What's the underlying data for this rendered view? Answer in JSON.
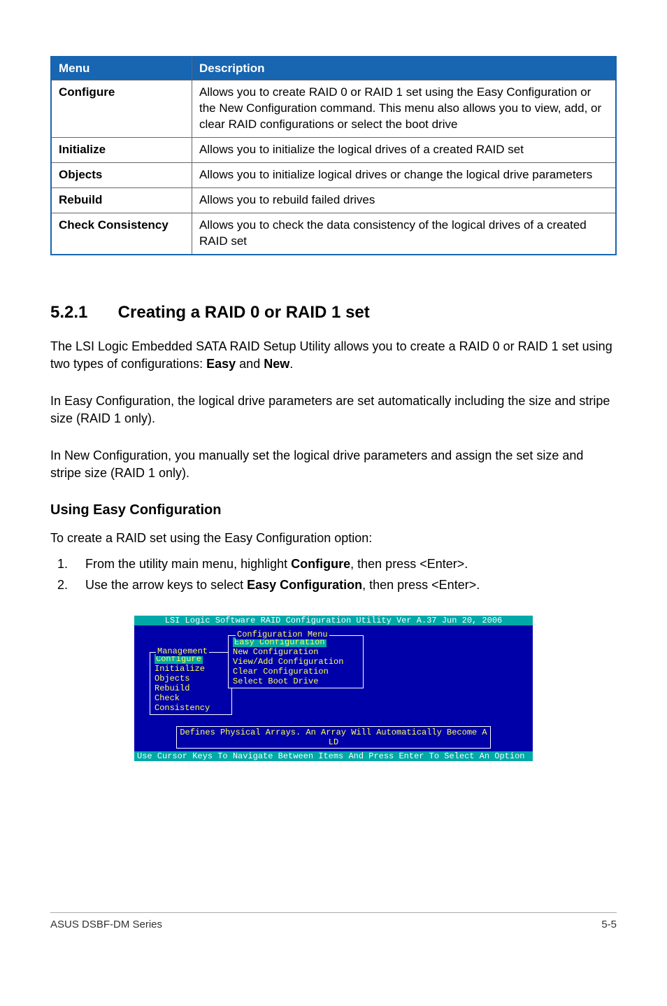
{
  "table": {
    "header": {
      "menu": "Menu",
      "desc": "Description"
    },
    "rows": [
      {
        "menu": "Configure",
        "desc": "Allows you to create RAID 0 or RAID 1 set using the Easy Configuration or the New Configuration command. This menu also allows you to view, add, or clear RAID configurations or select the boot drive"
      },
      {
        "menu": "Initialize",
        "desc": "Allows you to initialize the logical drives of a created RAID set"
      },
      {
        "menu": "Objects",
        "desc": "Allows you to initialize logical drives or change the logical drive parameters"
      },
      {
        "menu": "Rebuild",
        "desc": "Allows you to rebuild failed drives"
      },
      {
        "menu": "Check Consistency",
        "desc": "Allows you to check the data consistency of the logical drives of a created RAID set"
      }
    ]
  },
  "heading": {
    "number": "5.2.1",
    "title": "Creating a RAID 0 or RAID 1 set"
  },
  "para1_pre": "The LSI Logic Embedded SATA RAID Setup Utility allows you to create a RAID 0 or RAID 1 set using two types of configurations: ",
  "para1_easy": "Easy",
  "para1_and": " and ",
  "para1_new": "New",
  "para1_post": ".",
  "para2": "In Easy Configuration, the logical drive parameters are set automatically including the size and stripe size (RAID 1 only).",
  "para3": "In New Configuration, you manually set the logical drive parameters and assign the set size and stripe size (RAID 1 only).",
  "subheading": "Using Easy Configuration",
  "para4": "To create a RAID set using the Easy Configuration option:",
  "step1_num": "1.",
  "step1_pre": "From the utility main menu, highlight ",
  "step1_bold": "Configure",
  "step1_post": ", then press <Enter>.",
  "step2_num": "2.",
  "step2_pre": "Use the arrow keys to select ",
  "step2_bold": "Easy Configuration",
  "step2_post": ", then press <Enter>.",
  "bios": {
    "title": "LSI Logic Software RAID Configuration Utility Ver A.37 Jun 20, 2006",
    "mgmt_label": "Management",
    "mgmt_items": [
      "Configure",
      "Initialize",
      "Objects",
      "Rebuild",
      "Check Consistency"
    ],
    "cfg_label": "Configuration Menu",
    "cfg_items": [
      "Easy Configuration",
      "New Configuration",
      "View/Add Configuration",
      "Clear Configuration",
      "Select Boot Drive"
    ],
    "defines": "Defines Physical Arrays. An Array Will Automatically Become A LD",
    "status": "Use Cursor Keys To Navigate Between Items And Press Enter To Select An Option"
  },
  "footer_left": "ASUS DSBF-DM Series",
  "footer_right": "5-5"
}
